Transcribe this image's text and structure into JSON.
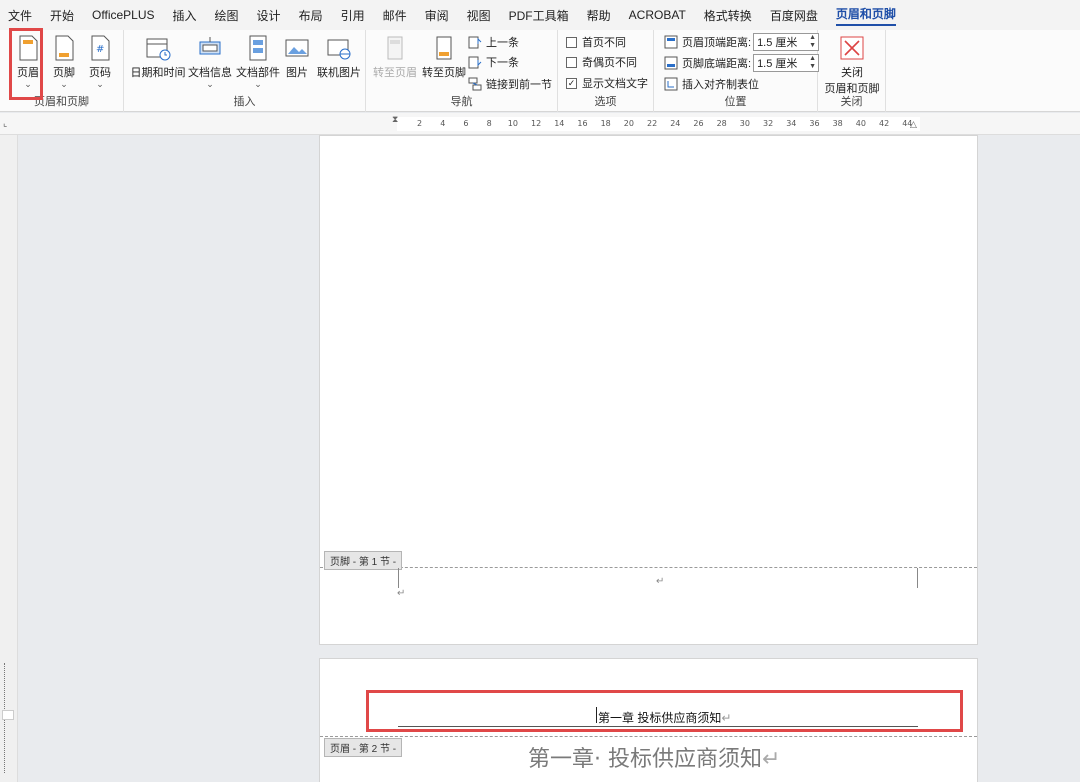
{
  "menu": {
    "tabs": [
      "文件",
      "开始",
      "OfficePLUS",
      "插入",
      "绘图",
      "设计",
      "布局",
      "引用",
      "邮件",
      "审阅",
      "视图",
      "PDF工具箱",
      "帮助",
      "ACROBAT",
      "格式转换",
      "百度网盘",
      "页眉和页脚"
    ],
    "active": "页眉和页脚"
  },
  "ribbon": {
    "hf_group": {
      "label": "页眉和页脚",
      "header": "页眉",
      "footer": "页脚",
      "page_number": "页码"
    },
    "insert_group": {
      "label": "插入",
      "datetime": "日期和时间",
      "docinfo": "文档信息",
      "docparts": "文档部件",
      "picture": "图片",
      "online_picture": "联机图片"
    },
    "nav_group": {
      "label": "导航",
      "goto_header": "转至页眉",
      "goto_footer": "转至页脚",
      "prev": "上一条",
      "next": "下一条",
      "link_prev": "链接到前一节"
    },
    "options_group": {
      "label": "选项",
      "diff_first": "首页不同",
      "diff_odd_even": "奇偶页不同",
      "show_doc_text": "显示文档文字",
      "show_doc_text_checked": true
    },
    "position_group": {
      "label": "位置",
      "header_top_label": "页眉顶端距离:",
      "header_top_value": "1.5 厘米",
      "footer_bottom_label": "页脚底端距离:",
      "footer_bottom_value": "1.5 厘米",
      "insert_align_tab": "插入对齐制表位"
    },
    "close_group": {
      "label": "关闭",
      "close_line1": "关闭",
      "close_line2": "页眉和页脚"
    }
  },
  "ruler_ticks": [
    "2",
    "4",
    "6",
    "8",
    "10",
    "12",
    "14",
    "16",
    "18",
    "20",
    "22",
    "24",
    "26",
    "28",
    "30",
    "32",
    "34",
    "36",
    "38",
    "40",
    "42",
    "44"
  ],
  "page1": {
    "footer_tag": "页脚 - 第 1 节 -",
    "para_mark": "↵"
  },
  "page2": {
    "header_tag": "页眉 - 第 2 节 -",
    "header_text": "第一章  投标供应商须知",
    "body_heading": "第一章· 投标供应商须知",
    "para_mark": "↵"
  },
  "colors": {
    "accent": "#1f4fa8",
    "highlight": "#e04848"
  }
}
